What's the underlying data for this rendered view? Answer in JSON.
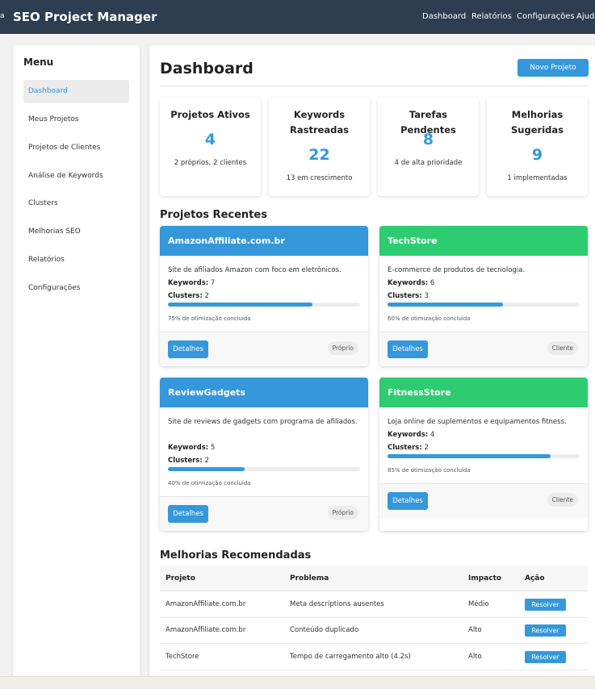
{
  "app": {
    "edge_glyph": "a",
    "title": "SEO Project Manager",
    "nav": [
      "Dashboard",
      "Relatórios",
      "Configurações",
      "Ajuda"
    ]
  },
  "sidebar": {
    "title": "Menu",
    "items": [
      {
        "label": "Dashboard",
        "active": true
      },
      {
        "label": "Meus Projetos"
      },
      {
        "label": "Projetos de Clientes"
      },
      {
        "label": "Análise de Keywords"
      },
      {
        "label": "Clusters"
      },
      {
        "label": "Melhorias SEO"
      },
      {
        "label": "Relatórios"
      },
      {
        "label": "Configurações"
      }
    ]
  },
  "main": {
    "title": "Dashboard",
    "new_project_label": "Novo Projeto",
    "stats": [
      {
        "title": "Projetos Ativos",
        "value": "4",
        "sub": "2 próprios, 2 clientes"
      },
      {
        "title": "Keywords Rastreadas",
        "value": "22",
        "sub": "13 em crescimento"
      },
      {
        "title": "Tarefas Pendentes",
        "value": "8",
        "sub": "4 de alta prioridade"
      },
      {
        "title": "Melhorias Sugeridas",
        "value": "9",
        "sub": "1 implementadas"
      }
    ],
    "recent_title": "Projetos Recentes",
    "projects": [
      {
        "name": "AmazonAffiliate.com.br",
        "desc": "Site de afiliados Amazon com foco em eletrônicos.",
        "keywords_label": "Keywords:",
        "keywords": "7",
        "clusters_label": "Clusters:",
        "clusters": "2",
        "progress": 0.75,
        "progress_text": "75% de otimização concluída",
        "details_label": "Detalhes",
        "badge": "Próprio",
        "color": "#3498db"
      },
      {
        "name": "TechStore",
        "desc": "E-commerce de produtos de tecnologia.",
        "keywords_label": "Keywords:",
        "keywords": "6",
        "clusters_label": "Clusters:",
        "clusters": "3",
        "progress": 0.6,
        "progress_text": "60% de otimização concluída",
        "details_label": "Detalhes",
        "badge": "Cliente",
        "color": "#2ecc71"
      },
      {
        "name": "ReviewGadgets",
        "desc": "Site de reviews de gadgets com programa de afiliados.",
        "keywords_label": "Keywords:",
        "keywords": "5",
        "clusters_label": "Clusters:",
        "clusters": "2",
        "progress": 0.4,
        "progress_text": "40% de otimização concluída",
        "details_label": "Detalhes",
        "badge": "Próprio",
        "color": "#3498db"
      },
      {
        "name": "FitnessStore",
        "desc": "Loja online de suplementos e equipamentos fitness.",
        "keywords_label": "Keywords:",
        "keywords": "4",
        "clusters_label": "Clusters:",
        "clusters": "2",
        "progress": 0.85,
        "progress_text": "85% de otimização concluída",
        "details_label": "Detalhes",
        "badge": "Cliente",
        "color": "#2ecc71"
      }
    ],
    "improvements_title": "Melhorias Recomendadas",
    "table": {
      "headers": [
        "Projeto",
        "Problema",
        "Impacto",
        "Ação"
      ],
      "rows": [
        [
          "AmazonAffiliate.com.br",
          "Meta descriptions ausentes",
          "Médio",
          "Resolver"
        ],
        [
          "AmazonAffiliate.com.br",
          "Conteúdo duplicado",
          "Alto",
          "Resolver"
        ],
        [
          "TechStore",
          "Tempo de carregamento alto (4.2s)",
          "Alto",
          "Resolver"
        ]
      ]
    }
  }
}
